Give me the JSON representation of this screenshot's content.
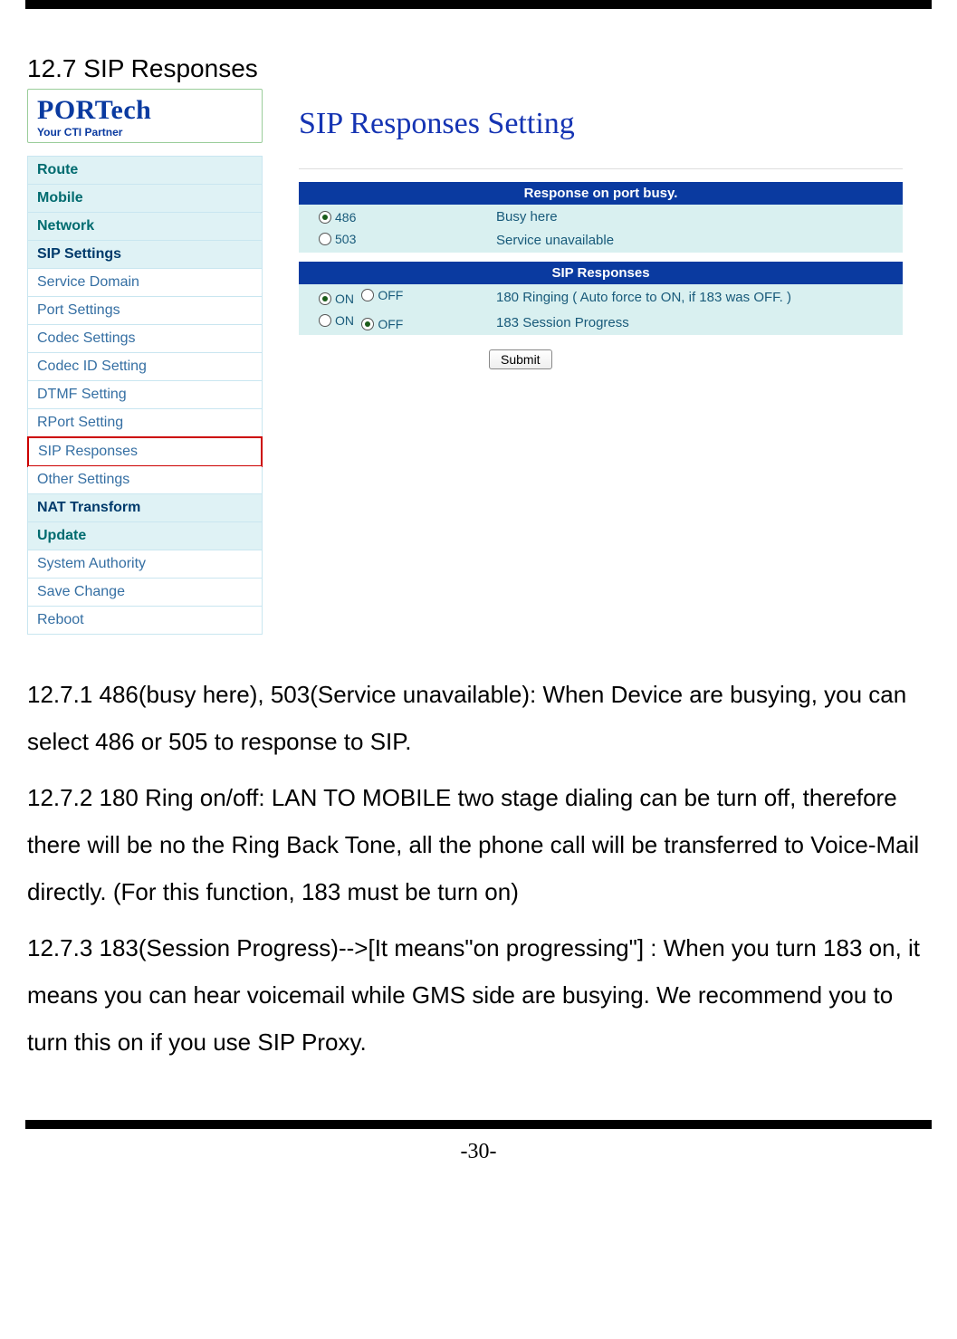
{
  "doc_section_title": "12.7 SIP Responses",
  "logo": {
    "brand": "PORTech",
    "tagline": "Your CTI Partner"
  },
  "sidebar": {
    "items": [
      {
        "label": "Route",
        "kind": "maj"
      },
      {
        "label": "Mobile",
        "kind": "maj"
      },
      {
        "label": "Network",
        "kind": "maj"
      },
      {
        "label": "SIP Settings",
        "kind": "maj dark"
      },
      {
        "label": "Service Domain",
        "kind": "sub"
      },
      {
        "label": "Port Settings",
        "kind": "sub"
      },
      {
        "label": "Codec Settings",
        "kind": "sub"
      },
      {
        "label": "Codec ID Setting",
        "kind": "sub"
      },
      {
        "label": "DTMF Setting",
        "kind": "sub"
      },
      {
        "label": "RPort Setting",
        "kind": "sub"
      },
      {
        "label": "SIP Responses",
        "kind": "sub-active"
      },
      {
        "label": "Other Settings",
        "kind": "sub"
      },
      {
        "label": "NAT Transform",
        "kind": "maj dark"
      },
      {
        "label": "Update",
        "kind": "maj"
      },
      {
        "label": "System Authority",
        "kind": "sub"
      },
      {
        "label": "Save Change",
        "kind": "sub"
      },
      {
        "label": "Reboot",
        "kind": "sub"
      }
    ]
  },
  "content": {
    "heading": "SIP Responses Setting",
    "table1": {
      "header": "Response on port busy.",
      "rows": [
        {
          "code": "486",
          "desc": "Busy here",
          "selected": true
        },
        {
          "code": "503",
          "desc": "Service unavailable",
          "selected": false
        }
      ]
    },
    "table2": {
      "header": "SIP Responses",
      "rows": [
        {
          "on": true,
          "off": false,
          "desc": "180 Ringing ( Auto force to ON, if 183 was OFF. )"
        },
        {
          "on": false,
          "off": true,
          "desc": "183 Session Progress"
        }
      ],
      "on_label": "ON",
      "off_label": "OFF"
    },
    "submit_label": "Submit"
  },
  "paragraphs": [
    "12.7.1 486(busy here), 503(Service unavailable): When Device are busying, you can select 486 or 505 to response to SIP.",
    "12.7.2 180 Ring on/off: LAN TO MOBILE two stage dialing can be turn off, therefore there will be no the Ring Back Tone, all the phone call will be transferred to Voice-Mail directly. (For this function, 183 must be turn on)",
    "12.7.3 183(Session Progress)-->[It means\"on progressing\"] : When you turn 183 on, it means you can hear voicemail while GMS side are busying.   We recommend you to turn this on if you use SIP Proxy."
  ],
  "page_number": "-30-"
}
